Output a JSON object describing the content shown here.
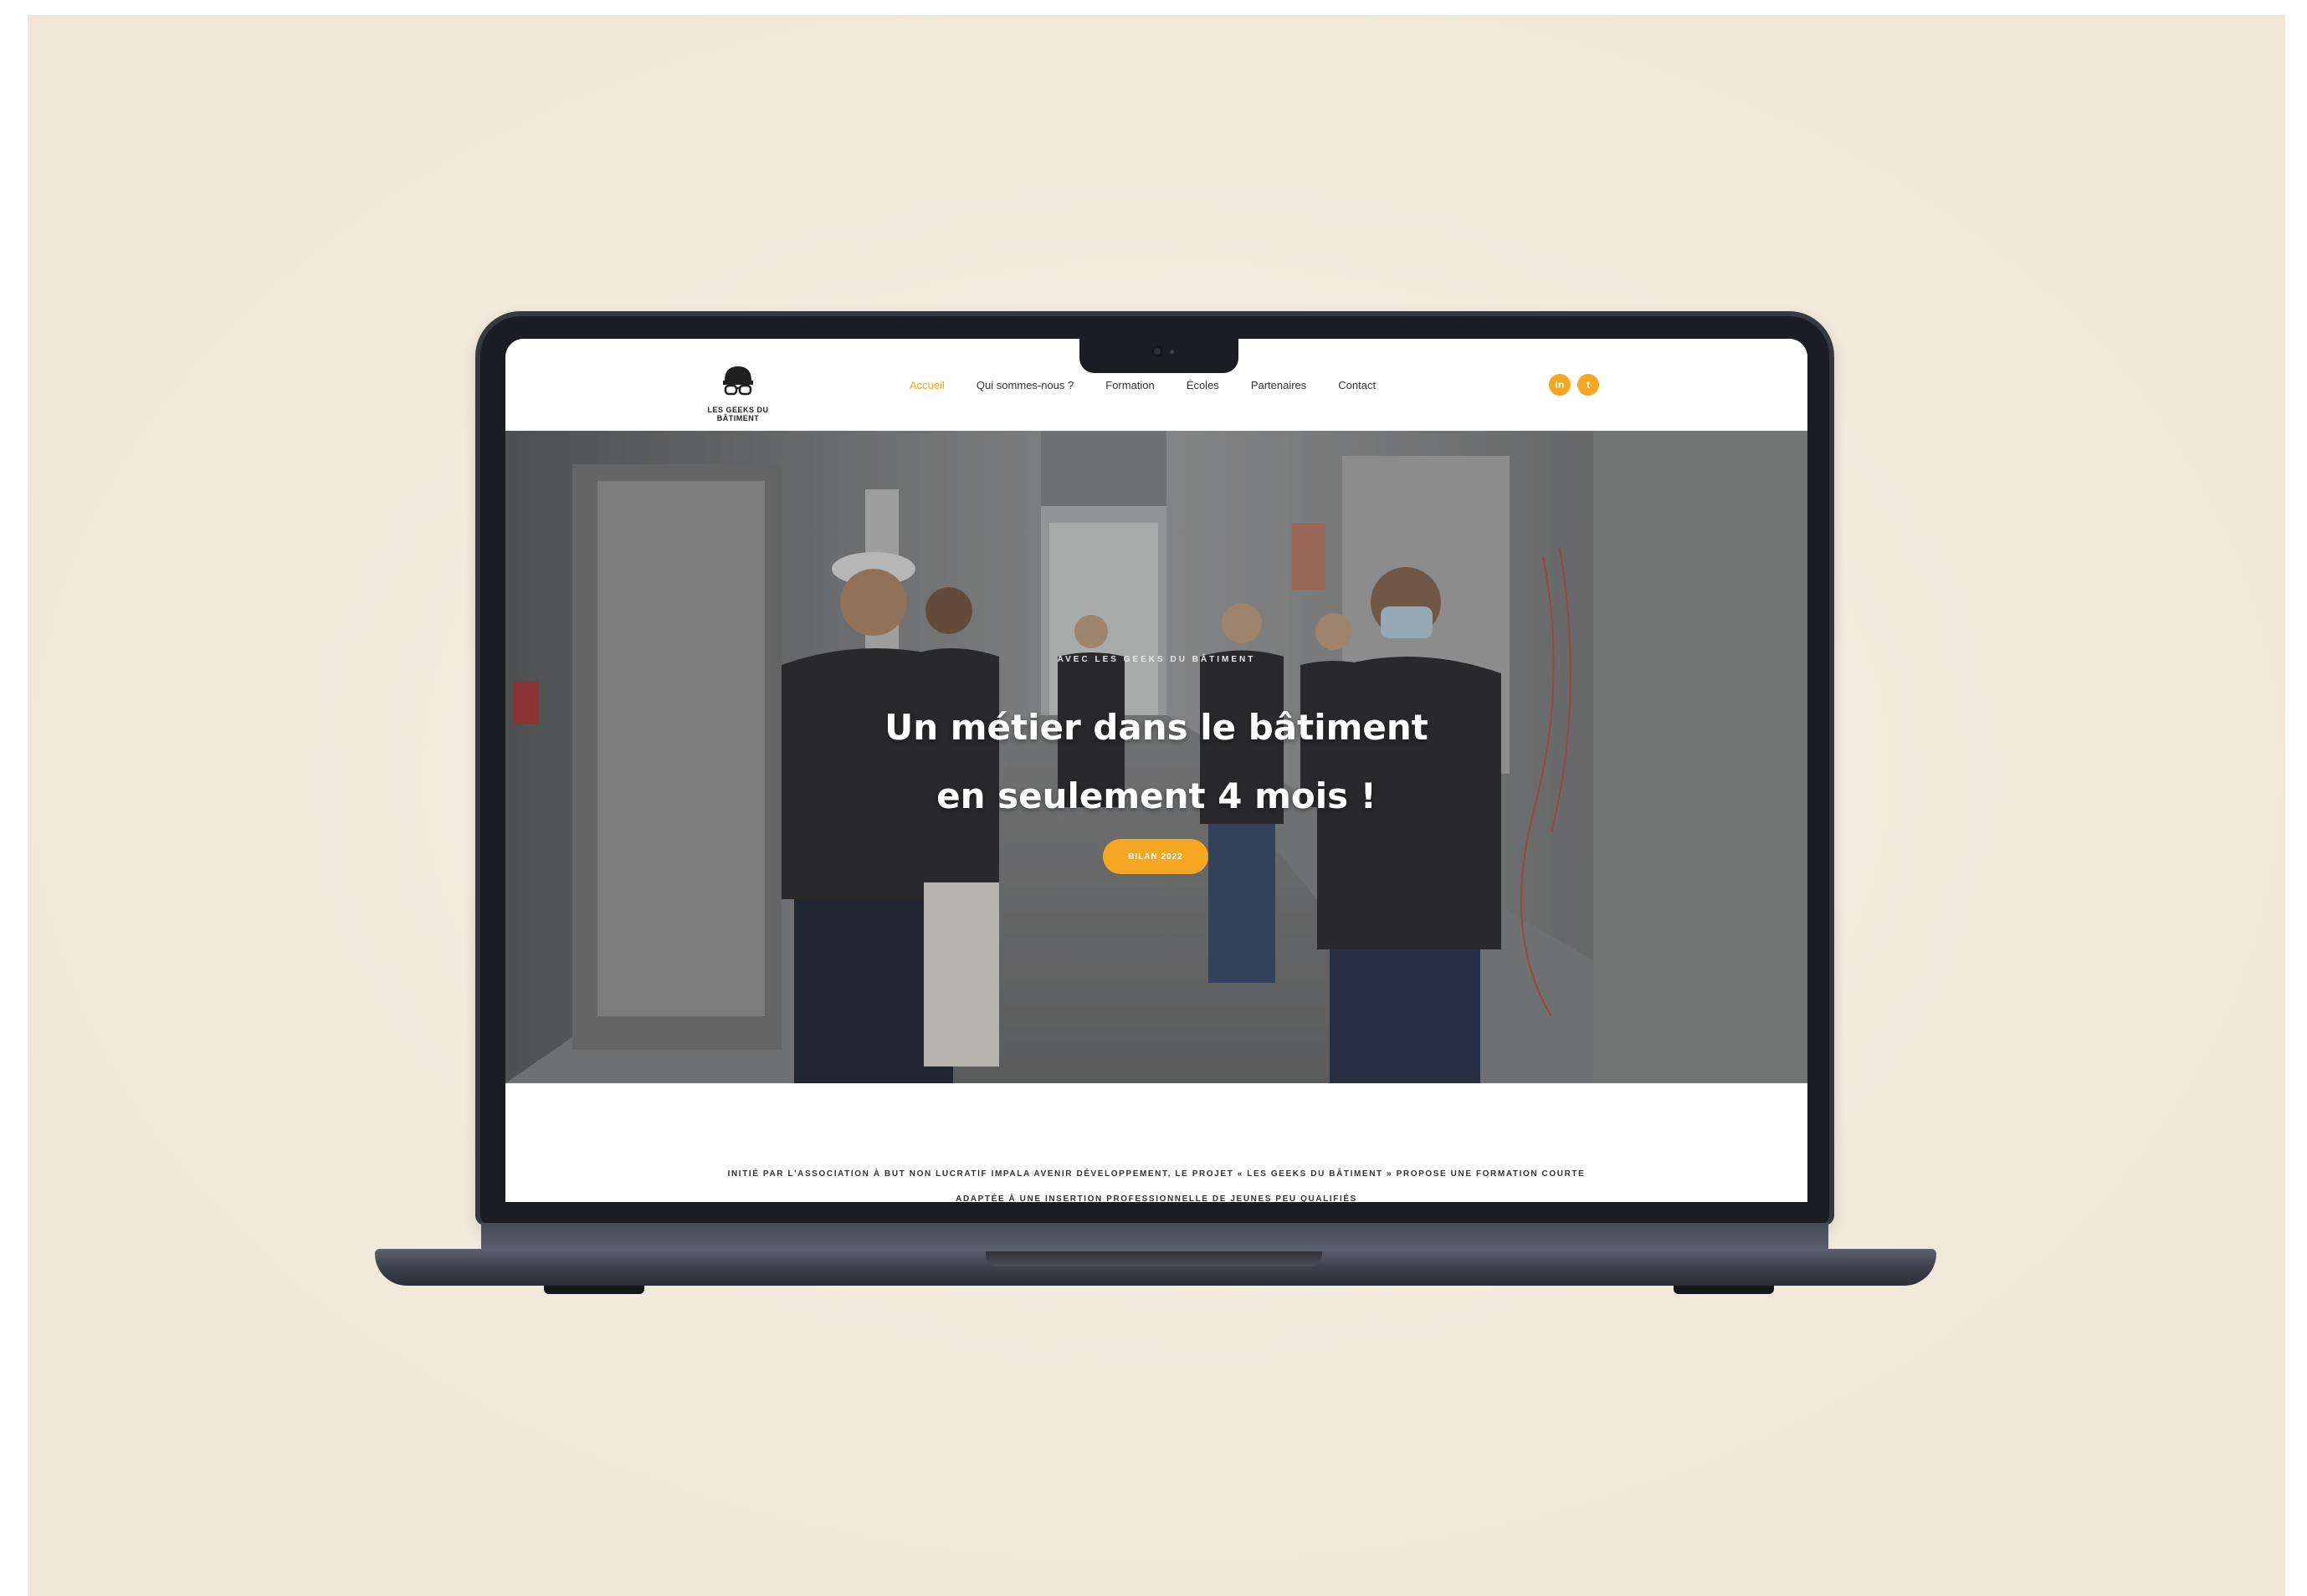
{
  "site": {
    "logo_text": "LES GEEKS DU BÂTIMENT",
    "nav": {
      "items": [
        {
          "label": "Accueil",
          "active": true
        },
        {
          "label": "Qui sommes-nous ?"
        },
        {
          "label": "Formation"
        },
        {
          "label": "Écoles"
        },
        {
          "label": "Partenaires"
        },
        {
          "label": "Contact"
        }
      ],
      "social": [
        {
          "icon": "linkedin-icon",
          "glyph": "in"
        },
        {
          "icon": "twitter-icon",
          "glyph": "t"
        }
      ]
    },
    "hero": {
      "kicker": "AVEC LES GEEKS DU BÂTIMENT",
      "title_line1": "Un métier dans le bâtiment",
      "title_line2": "en seulement 4 mois !",
      "cta_label": "BILAN 2022"
    },
    "intro": {
      "line1": "INITIÉ PAR L'ASSOCIATION À BUT NON LUCRATIF IMPALA AVENIR DÉVELOPPEMENT, LE PROJET « LES GEEKS DU BÂTIMENT » PROPOSE UNE FORMATION COURTE",
      "line2": "ADAPTÉE À UNE INSERTION PROFESSIONNELLE DE JEUNES PEU QUALIFIÉS"
    },
    "colors": {
      "accent": "#f5a623",
      "backdrop": "#f3ece0"
    }
  }
}
